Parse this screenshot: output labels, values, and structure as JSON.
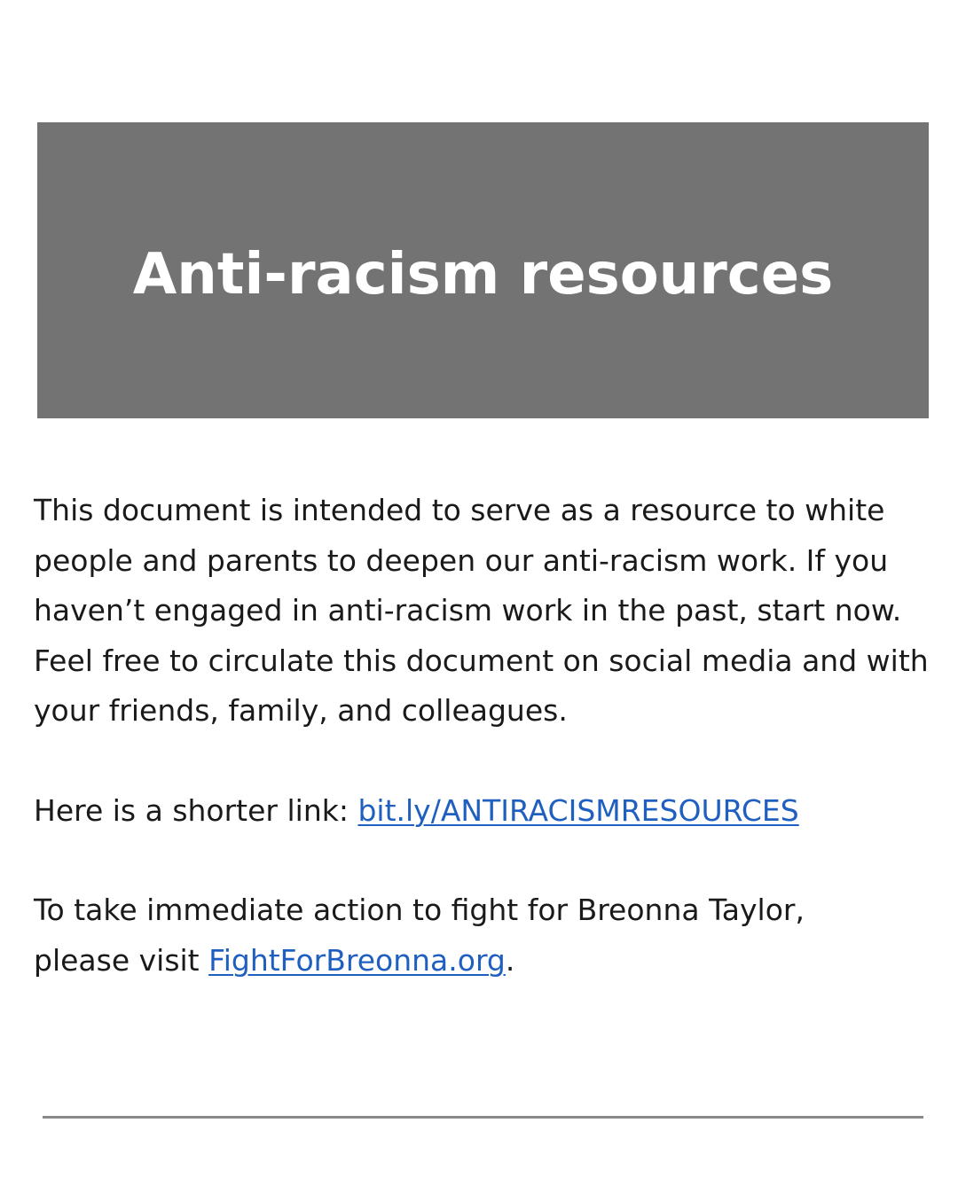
{
  "banner": {
    "title": "Anti-racism resources",
    "background_color": "#737373"
  },
  "intro": {
    "text": "This document is intended to serve as a resource to white people and parents to deepen our anti-racism work. If you haven’t engaged in anti-racism work in the past, start now. Feel free to circulate this document on social media and with your friends, family, and colleagues."
  },
  "shortlink": {
    "prefix": "Here is a shorter link: ",
    "link_text": "bit.ly/ANTIRACISMRESOURCES"
  },
  "action": {
    "line1": "To take immediate action to fight for Breonna Taylor,",
    "prefix": "please visit ",
    "link_text": "FightForBreonna.org",
    "suffix": "."
  },
  "colors": {
    "link": "#1f5fbf",
    "text": "#1a1a1a",
    "divider": "#8a8a8a"
  }
}
